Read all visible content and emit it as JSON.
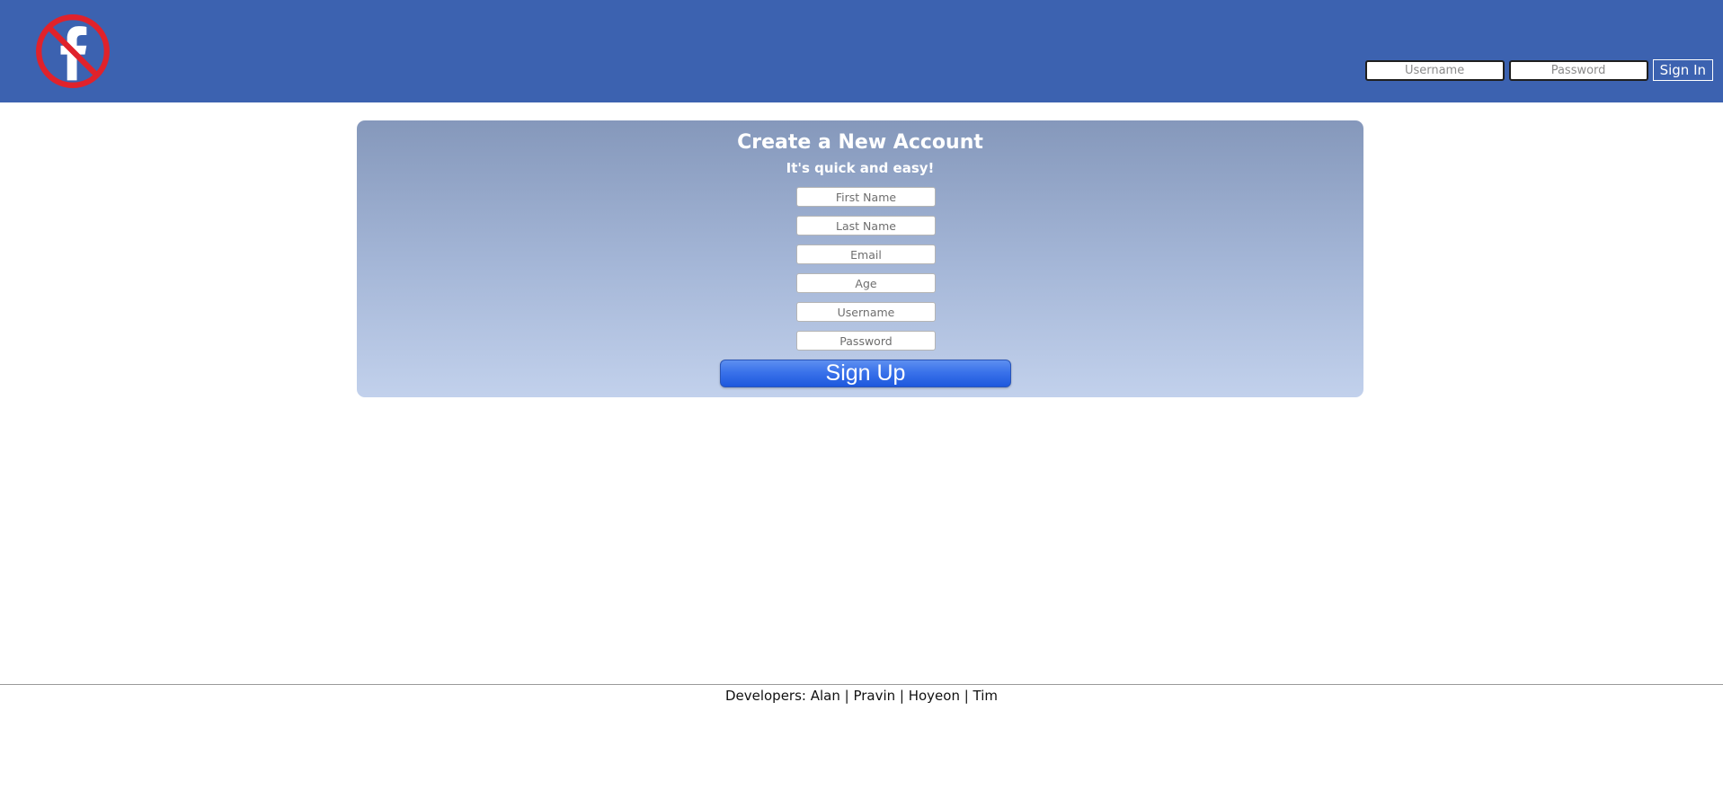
{
  "header": {
    "logo_icon": "facebook-prohibited-icon",
    "colors": {
      "background": "#3c62b0",
      "logo_ring": "#e0222b",
      "logo_f": "#ffffff"
    },
    "signin": {
      "username_placeholder": "Username",
      "password_placeholder": "Password",
      "button_label": "Sign In"
    }
  },
  "signup": {
    "title": "Create a New Account",
    "subtitle": "It's quick and easy!",
    "fields": {
      "first_name": "First Name",
      "last_name": "Last Name",
      "email": "Email",
      "age": "Age",
      "username": "Username",
      "password": "Password"
    },
    "button_label": "Sign Up"
  },
  "footer": {
    "text": "Developers: Alan | Pravin | Hoyeon | Tim"
  }
}
